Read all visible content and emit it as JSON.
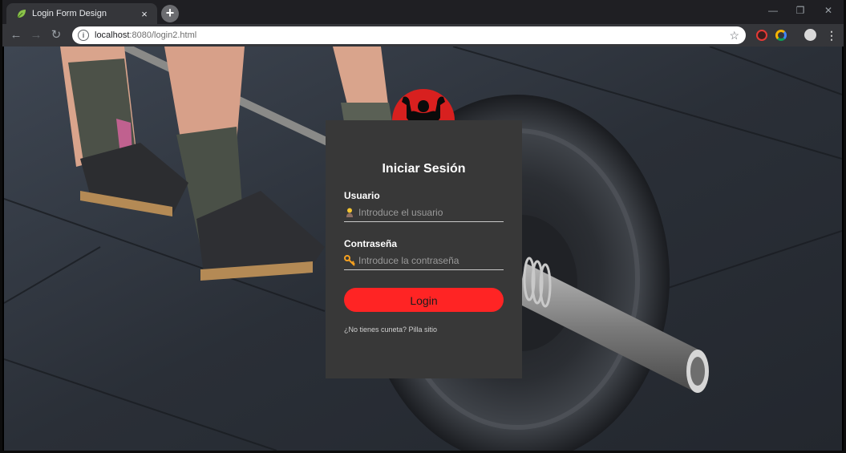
{
  "browser": {
    "tab_title": "Login Form Design",
    "tab_close": "×",
    "new_tab": "+",
    "url_host": "localhost",
    "url_rest": ":8080/login2.html",
    "window_controls": [
      "—",
      "❐",
      "✕"
    ],
    "nav": {
      "back": "←",
      "forward": "→",
      "reload": "↻"
    },
    "icons": [
      "leaf-favicon-icon",
      "info-icon",
      "star-icon",
      "extension-icons",
      "menu-icon"
    ]
  },
  "login": {
    "title": "Iniciar Sesión",
    "user_label": "Usuario",
    "user_placeholder": "Introduce el usuario",
    "password_label": "Contraseña",
    "password_placeholder": "Introduce la contraseña",
    "button_label": "Login",
    "register_link": "¿No tienes cuneta? Pilla sitio"
  },
  "colors": {
    "accent": "#ff2424",
    "card": "#383838",
    "avatar": "#d8201f"
  }
}
